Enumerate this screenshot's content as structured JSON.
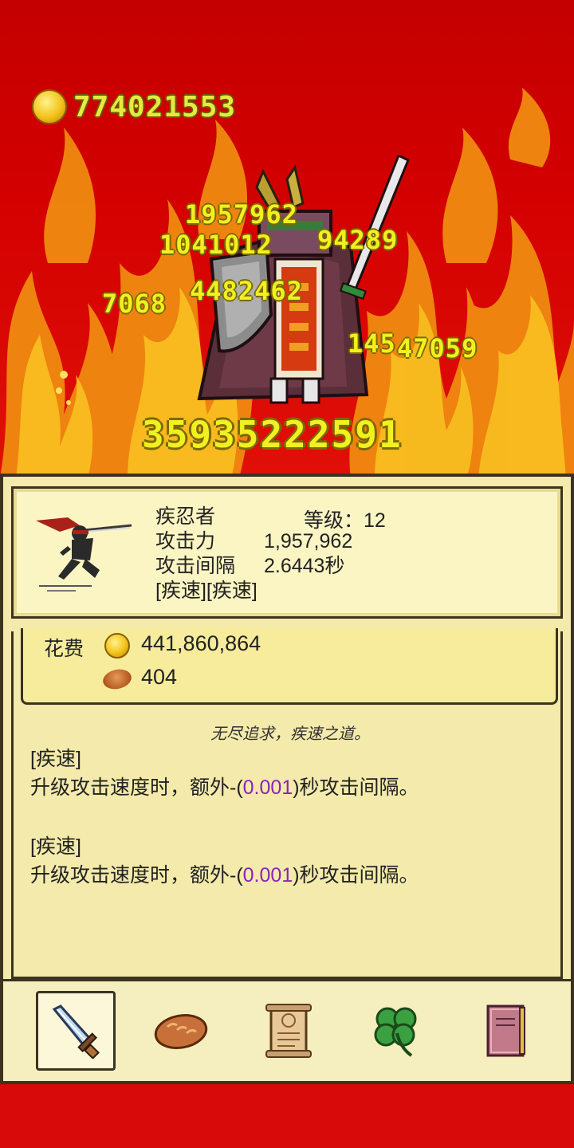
{
  "hud": {
    "gold": "774021553"
  },
  "damage_numbers": [
    "1957962",
    "1041012",
    "94289",
    "7068",
    "4482462",
    "145",
    "47059"
  ],
  "total_damage": "35935222591",
  "hero": {
    "name": "疾忍者",
    "level_label": "等级：12",
    "attack_label": "攻击力",
    "attack_value": "1,957,962",
    "interval_label": "攻击间隔",
    "interval_value": "2.6443秒",
    "tags": "[疾速][疾速]"
  },
  "cost": {
    "label": "花费",
    "gold": "441,860,864",
    "bread": "404"
  },
  "motto": "无尽追求，疾速之道。",
  "skills": [
    {
      "title": "[疾速]",
      "pre": "升级攻击速度时，额外-(",
      "value": "0.001",
      "post": ")秒攻击间隔。"
    },
    {
      "title": "[疾速]",
      "pre": "升级攻击速度时，额外-(",
      "value": "0.001",
      "post": ")秒攻击间隔。"
    }
  ],
  "tabs": [
    "sword-icon",
    "bread-icon",
    "scroll-icon",
    "clover-icon",
    "book-icon"
  ],
  "colors": {
    "accent_yellow": "#f2f020",
    "panel_bg": "#f3eaab",
    "highlight_value": "#8a24b8"
  }
}
